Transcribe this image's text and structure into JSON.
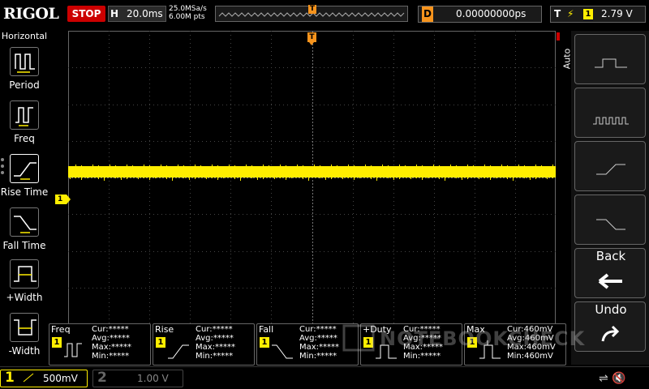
{
  "header": {
    "brand": "RIGOL",
    "run_state": "STOP",
    "horizontal_label": "H",
    "horizontal_scale": "20.0ms",
    "sample_rate": "25.0MSa/s",
    "memory_depth": "6.00M pts",
    "trigger_marker": "T",
    "delay_label": "D",
    "delay_value": "0.00000000ps",
    "trigger_label": "T",
    "trigger_edge_icon": "rising-edge-icon",
    "trigger_source": "1",
    "trigger_level": "2.79 V"
  },
  "left_menu": {
    "title": "Horizontal",
    "items": [
      {
        "label": "Period",
        "icon": "period-icon"
      },
      {
        "label": "Freq",
        "icon": "frequency-icon"
      },
      {
        "label": "Rise Time",
        "icon": "rise-time-icon"
      },
      {
        "label": "Fall Time",
        "icon": "fall-time-icon"
      },
      {
        "label": "+Width",
        "icon": "positive-width-icon"
      },
      {
        "label": "-Width",
        "icon": "negative-width-icon"
      }
    ]
  },
  "right_panel": {
    "mode_label": "Auto",
    "buttons": [
      {
        "icon": "single-pulse-icon"
      },
      {
        "icon": "pulse-train-icon"
      },
      {
        "icon": "rise-ramp-icon"
      },
      {
        "icon": "fall-ramp-icon"
      },
      {
        "label": "Back",
        "icon": "back-arrow-icon"
      },
      {
        "label": "Undo",
        "icon": "undo-icon"
      }
    ]
  },
  "waveform": {
    "channel_marker": "1",
    "trigger_marker": "T",
    "color": "#ffee00"
  },
  "measurements": [
    {
      "name": "Freq",
      "channel": "1",
      "cur": "Cur:*****",
      "avg": "Avg:*****",
      "max": "Max:*****",
      "min": "Min:*****"
    },
    {
      "name": "Rise",
      "channel": "1",
      "cur": "Cur:*****",
      "avg": "Avg:*****",
      "max": "Max:*****",
      "min": "Min:*****"
    },
    {
      "name": "Fall",
      "channel": "1",
      "cur": "Cur:*****",
      "avg": "Avg:*****",
      "max": "Max:*****",
      "min": "Min:*****"
    },
    {
      "name": "+Duty",
      "channel": "1",
      "cur": "Cur:*****",
      "avg": "Avg:*****",
      "max": "Max:*****",
      "min": "Min:*****"
    },
    {
      "name": "Max",
      "channel": "1",
      "cur": "Cur:460mV",
      "avg": "Avg:460mV",
      "max": "Max:460mV",
      "min": "Min:460mV"
    }
  ],
  "channels": {
    "ch1_number": "1",
    "ch1_scale": "500mV",
    "ch2_number": "2",
    "ch2_scale": "1.00 V"
  },
  "watermark": "NOTEBOOKCHECK",
  "colors": {
    "trace": "#ffee00",
    "trigger": "#f7941d",
    "stop": "#cc0000"
  }
}
